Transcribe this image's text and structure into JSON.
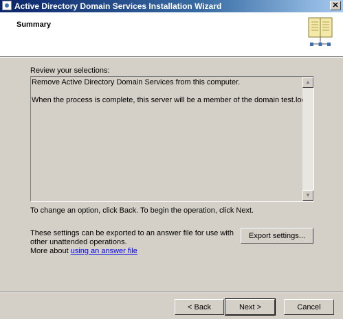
{
  "window": {
    "title": "Active Directory Domain Services Installation Wizard",
    "close_glyph": "✕"
  },
  "header": {
    "title": "Summary"
  },
  "review": {
    "label": "Review your selections:",
    "lines": [
      "Remove Active Directory Domain Services from this computer.",
      "When the process is complete, this server will be a member of the domain test.local"
    ]
  },
  "instruction": "To change an option, click Back. To begin the operation, click Next.",
  "export": {
    "text_line1": "These settings can be exported to an answer file for use with",
    "text_line2": "other unattended operations.",
    "more_prefix": "More about ",
    "link": "using an answer file",
    "button": "Export settings..."
  },
  "footer": {
    "back": "< Back",
    "next": "Next >",
    "cancel": "Cancel"
  },
  "scroll": {
    "up_glyph": "▲",
    "down_glyph": "▼"
  }
}
